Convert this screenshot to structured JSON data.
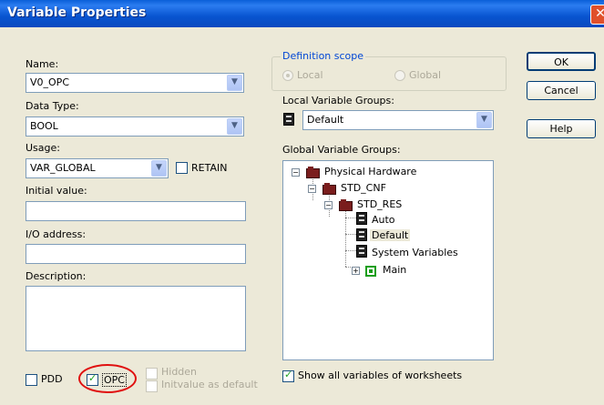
{
  "window": {
    "title": "Variable Properties",
    "close_glyph": "✕"
  },
  "name": {
    "label": "Name:",
    "value": "V0_OPC"
  },
  "data_type": {
    "label": "Data Type:",
    "value": "BOOL"
  },
  "usage": {
    "label": "Usage:",
    "value": "VAR_GLOBAL",
    "retain_label": "RETAIN",
    "retain_checked": false
  },
  "initial_value": {
    "label": "Initial value:",
    "value": ""
  },
  "io_address": {
    "label": "I/O address:",
    "value": ""
  },
  "description": {
    "label": "Description:",
    "value": ""
  },
  "flags": {
    "pdd": {
      "label": "PDD",
      "checked": false
    },
    "opc": {
      "label": "OPC",
      "checked": true
    },
    "hidden": {
      "label": "Hidden",
      "checked": false,
      "enabled": false
    },
    "initvalue_default": {
      "label": "Initvalue as default",
      "checked": false,
      "enabled": false
    }
  },
  "definition_scope": {
    "title": "Definition scope",
    "local_label": "Local",
    "global_label": "Global",
    "selected": "Local"
  },
  "local_groups": {
    "label": "Local Variable Groups:",
    "value": "Default"
  },
  "global_groups": {
    "label": "Global Variable Groups:",
    "tree": {
      "physical_hardware": "Physical Hardware",
      "std_cnf": "STD_CNF",
      "std_res": "STD_RES",
      "auto": "Auto",
      "default": "Default",
      "system_variables": "System Variables",
      "main": "Main"
    },
    "selected": "Default"
  },
  "show_all": {
    "label": "Show all variables of worksheets",
    "checked": true
  },
  "buttons": {
    "ok": "OK",
    "cancel": "Cancel",
    "help": "Help"
  },
  "colors": {
    "title_bar": "#0a5fd8",
    "highlight_ellipse": "#e01010",
    "group_title": "#0046d5"
  }
}
